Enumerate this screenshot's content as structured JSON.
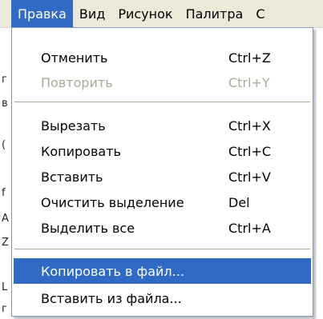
{
  "menubar": {
    "items": [
      {
        "label": "Правка"
      },
      {
        "label": "Вид"
      },
      {
        "label": "Рисунок"
      },
      {
        "label": "Палитра"
      },
      {
        "label": "С"
      }
    ]
  },
  "dropdown": {
    "items": [
      {
        "label": "Отменить",
        "shortcut": "Ctrl+Z",
        "enabled": true
      },
      {
        "label": "Повторить",
        "shortcut": "Ctrl+Y",
        "enabled": false
      },
      {
        "label": "Вырезать",
        "shortcut": "Ctrl+X",
        "enabled": true
      },
      {
        "label": "Копировать",
        "shortcut": "Ctrl+C",
        "enabled": true
      },
      {
        "label": "Вставить",
        "shortcut": "Ctrl+V",
        "enabled": true
      },
      {
        "label": "Очистить выделение",
        "shortcut": "Del",
        "enabled": true
      },
      {
        "label": "Выделить все",
        "shortcut": "Ctrl+A",
        "enabled": true
      },
      {
        "label": "Копировать в файл...",
        "shortcut": "",
        "enabled": true,
        "highlighted": true
      },
      {
        "label": "Вставить из файла...",
        "shortcut": "",
        "enabled": true
      }
    ]
  },
  "background": {
    "marks": [
      "г",
      "в",
      "(",
      "f",
      "А",
      "Z",
      "L",
      "г"
    ]
  },
  "colors": {
    "menubar_bg": "#ece9d8",
    "highlight": "#316ac5",
    "disabled_text": "#aca899"
  }
}
